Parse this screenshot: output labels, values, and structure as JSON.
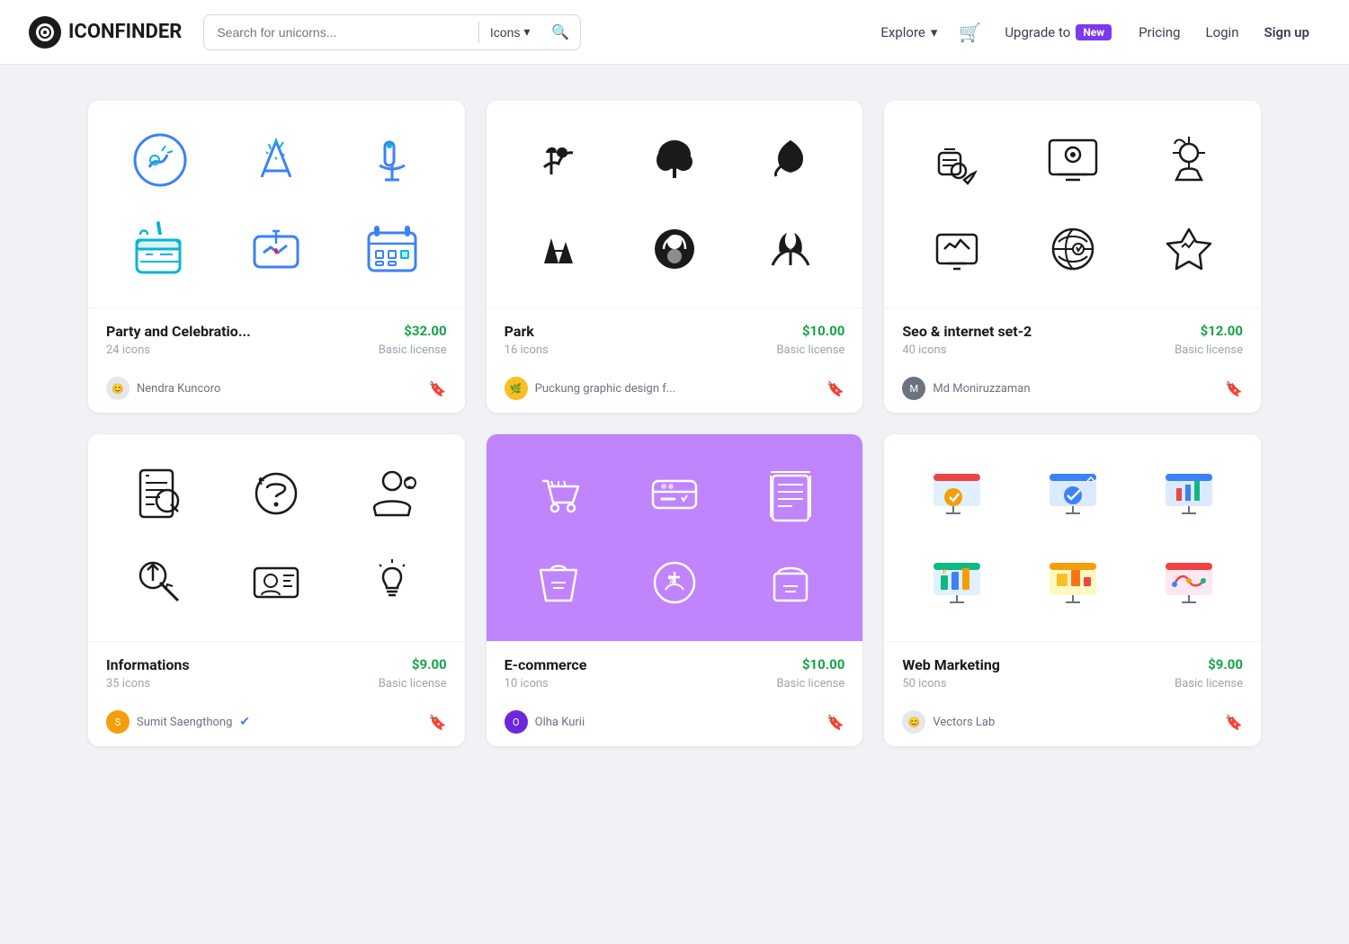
{
  "header": {
    "logo_text": "ICONFINDER",
    "search_placeholder": "Search for unicorns...",
    "search_type": "Icons",
    "explore_label": "Explore",
    "cart_label": "cart",
    "upgrade_label": "Upgrade to",
    "new_badge": "New",
    "pricing_label": "Pricing",
    "login_label": "Login",
    "signup_label": "Sign up"
  },
  "cards": [
    {
      "id": "party",
      "title": "Party and Celebratio...",
      "count": "24 icons",
      "price": "$32.00",
      "license": "Basic license",
      "author": "Nendra Kuncoro",
      "bg": "white"
    },
    {
      "id": "park",
      "title": "Park",
      "count": "16 icons",
      "price": "$10.00",
      "license": "Basic license",
      "author": "Puckung graphic design f...",
      "bg": "white"
    },
    {
      "id": "seo",
      "title": "Seo & internet set-2",
      "count": "40 icons",
      "price": "$12.00",
      "license": "Basic license",
      "author": "Md Moniruzzaman",
      "bg": "white"
    },
    {
      "id": "informations",
      "title": "Informations",
      "count": "35 icons",
      "price": "$9.00",
      "license": "Basic license",
      "author": "Sumit Saengthong",
      "verified": true,
      "bg": "white"
    },
    {
      "id": "ecommerce",
      "title": "E-commerce",
      "count": "10 icons",
      "price": "$10.00",
      "license": "Basic license",
      "author": "Olha Kurii",
      "bg": "purple"
    },
    {
      "id": "webmarketing",
      "title": "Web Marketing",
      "count": "50 icons",
      "price": "$9.00",
      "license": "Basic license",
      "author": "Vectors Lab",
      "bg": "white"
    }
  ]
}
